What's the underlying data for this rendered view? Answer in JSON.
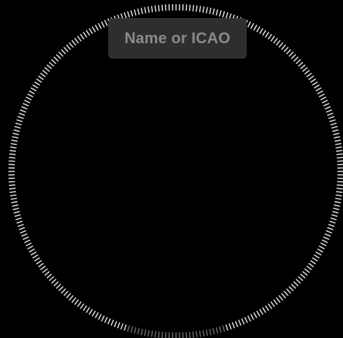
{
  "search": {
    "placeholder": "Name or ICAO",
    "value": ""
  },
  "dial": {
    "icon": "circular-tick-bezel",
    "tick_color": "#dcdcdc",
    "tick_dim_color": "#6a6a6a"
  },
  "colors": {
    "background": "#000000",
    "field_background": "#2e2e2e",
    "placeholder_text": "#8a8a8a"
  }
}
